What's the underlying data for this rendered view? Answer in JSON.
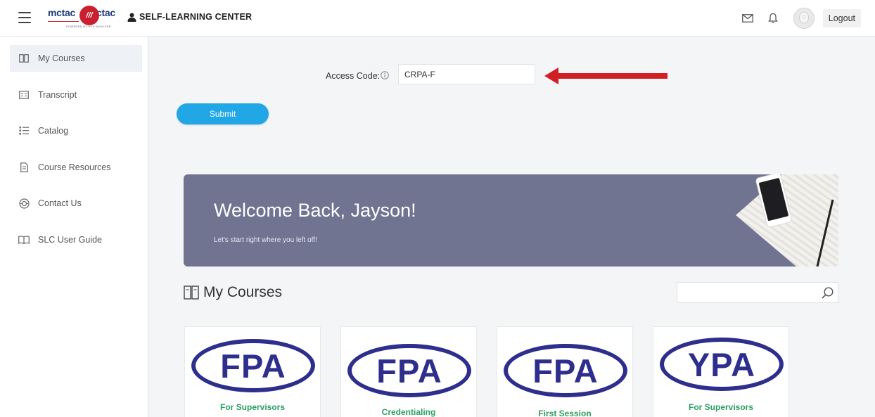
{
  "header": {
    "logo_left": "mctac",
    "logo_right": "ctac",
    "logo_subtitle": "POWERED BY NYU McSILVER",
    "brand": "SELF-LEARNING CENTER",
    "logout_label": "Logout"
  },
  "sidebar": {
    "items": [
      {
        "label": "My Courses",
        "icon": "book-open-icon"
      },
      {
        "label": "Transcript",
        "icon": "list-box-icon"
      },
      {
        "label": "Catalog",
        "icon": "list-icon"
      },
      {
        "label": "Course Resources",
        "icon": "document-icon"
      },
      {
        "label": "Contact Us",
        "icon": "headset-icon"
      },
      {
        "label": "SLC User Guide",
        "icon": "book-icon"
      }
    ]
  },
  "access": {
    "label": "Access Code:",
    "value": "CRPA-F"
  },
  "submit_label": "Submit",
  "banner": {
    "title": "Welcome Back, Jayson!",
    "subtitle": "Let's start right where you left off!"
  },
  "courses": {
    "title": "My Courses",
    "search_value": "",
    "cards": [
      {
        "badge": "FPA",
        "subtitle": "For Supervisors"
      },
      {
        "badge": "FPA",
        "subtitle": "Credentialing"
      },
      {
        "badge": "FPA",
        "subtitle": "First Session"
      },
      {
        "badge": "YPA",
        "subtitle": "For Supervisors"
      }
    ]
  },
  "colors": {
    "accent_blue": "#21a6e6",
    "banner": "#707491",
    "badge_navy": "#2e2e8c",
    "badge_green": "#2d9e62",
    "arrow_red": "#d11f26"
  }
}
